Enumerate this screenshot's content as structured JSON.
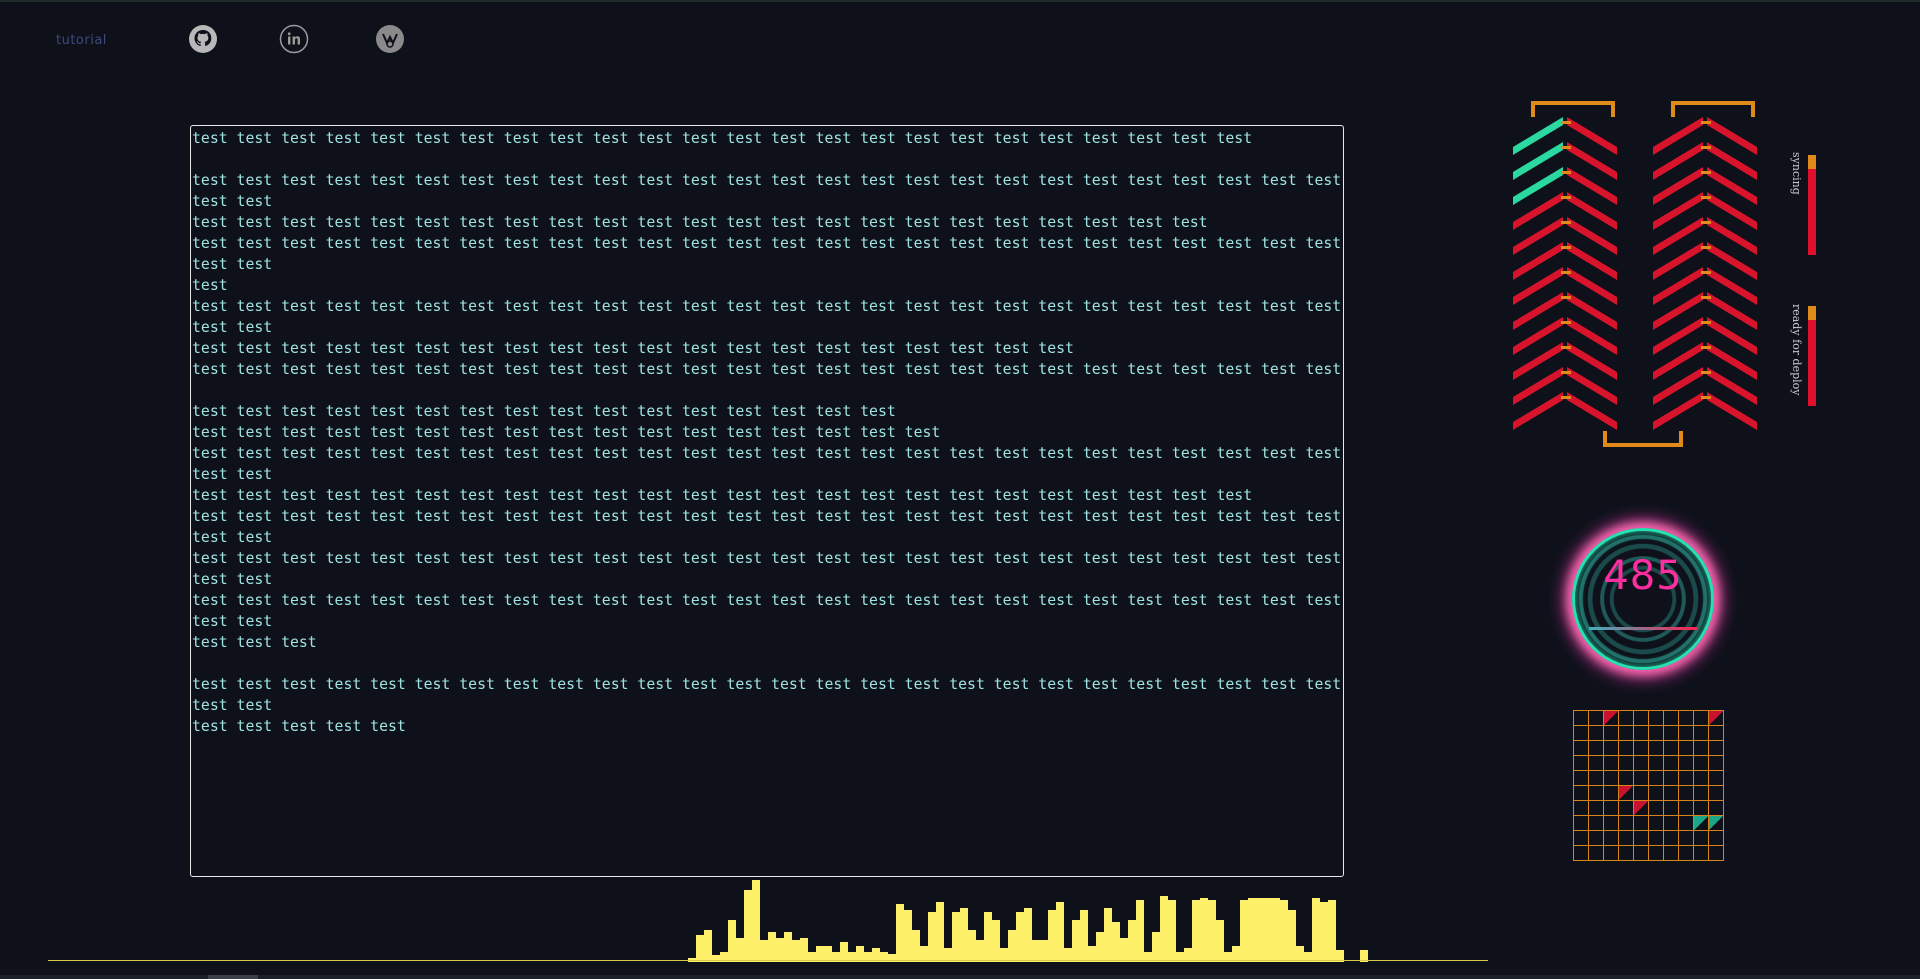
{
  "nav": {
    "tutorial_label": "tutorial",
    "icons": [
      "github-icon",
      "linkedin-icon",
      "dev-icon"
    ]
  },
  "editor": {
    "lines": [
      "test test test test test test test test test test test test test test test test test test test test test test test test",
      "",
      "test test test test test test test test test test test test test test test test test test test test test test test test test test test test",
      "test test test test test test test test test test test test test test test test test test test test test test test",
      "test test test test test test test test test test test test test test test test test test test test test test test test test test test test",
      "test",
      "test test test test test test test test test test test test test test test test test test test test test test test test test test test test",
      "test test test test test test test test test test test test test test test test test test test test",
      "test test test test test test test test test test test test test test test test test test test test test test test test test test",
      "",
      "test test test test test test test test test test test test test test test test",
      "test test test test test test test test test test test test test test test test test",
      "test test test test test test test test test test test test test test test test test test test test test test test test test test test test",
      "test test test test test test test test test test test test test test test test test test test test test test test test",
      "test test test test test test test test test test test test test test test test test test test test test test test test test test test test",
      "test test test test test test test test test test test test test test test test test test test test test test test test test test test test",
      "test test test test test test test test test test test test test test test test test test test test test test test test test test test test",
      "test test test",
      "",
      "test test test test test test test test test test test test test test test test test test test test test test test test test test test test",
      "test test test test test"
    ]
  },
  "status": {
    "syncing_label": "syncing",
    "deploy_label": "ready for deploy"
  },
  "gauge": {
    "value": "485"
  },
  "grid": {
    "rows": 10,
    "cols": 10,
    "red_cells": [
      2,
      9,
      53,
      64
    ],
    "green_cells": [
      78,
      79
    ]
  },
  "visualizer": {
    "bars": [
      0,
      0,
      2,
      25,
      30,
      5,
      8,
      40,
      22,
      70,
      80,
      20,
      28,
      22,
      28,
      20,
      22,
      8,
      14,
      14,
      8,
      18,
      8,
      14,
      8,
      12,
      8,
      6,
      56,
      50,
      30,
      14,
      48,
      58,
      12,
      48,
      52,
      30,
      20,
      48,
      40,
      12,
      30,
      48,
      52,
      20,
      20,
      50,
      58,
      12,
      40,
      50,
      14,
      28,
      52,
      38,
      22,
      40,
      60,
      8,
      28,
      64,
      60,
      8,
      12,
      60,
      62,
      60,
      40,
      8,
      14,
      60,
      62,
      62,
      62,
      62,
      60,
      50,
      14,
      8,
      62,
      58,
      60,
      10,
      0,
      0,
      10
    ]
  }
}
